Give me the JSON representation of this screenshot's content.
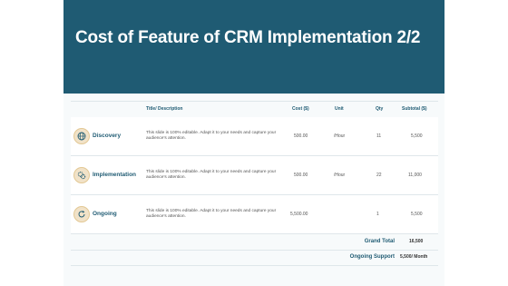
{
  "slide": {
    "title": "Cost of Feature of CRM Implementation 2/2"
  },
  "table": {
    "headers": [
      "Title/ Description",
      "Cost ($)",
      "Unit",
      "Qty",
      "Subtotal ($)"
    ],
    "rows": [
      {
        "feature": "Discovery",
        "icon": "globe-icon",
        "description": "This slide is 100% editable. Adapt it to your needs and capture your audience's attention.",
        "cost": "500.00",
        "unit": "/Hour",
        "qty": "11",
        "subtotal": "5,500"
      },
      {
        "feature": "Implementation",
        "icon": "gears-icon",
        "description": "This slide is 100% editable. Adapt it to your needs and capture your audience's attention.",
        "cost": "500.00",
        "unit": "/Hour",
        "qty": "22",
        "subtotal": "11,000"
      },
      {
        "feature": "Ongoing",
        "icon": "refresh-icon",
        "description": "This slide is 100% editable. Adapt it to your needs and capture your audience's attention.",
        "cost": "5,500.00",
        "unit": "",
        "qty": "1",
        "subtotal": "5,500"
      }
    ],
    "grand_total_label": "Grand Total",
    "grand_total_value": "16,500",
    "ongoing_support_label": "Ongoing Support",
    "ongoing_support_value": "5,500/ Month"
  },
  "colors": {
    "header": "#1f5b73",
    "accent": "#1f5b73",
    "icon_bg": "#f1e2c8"
  }
}
